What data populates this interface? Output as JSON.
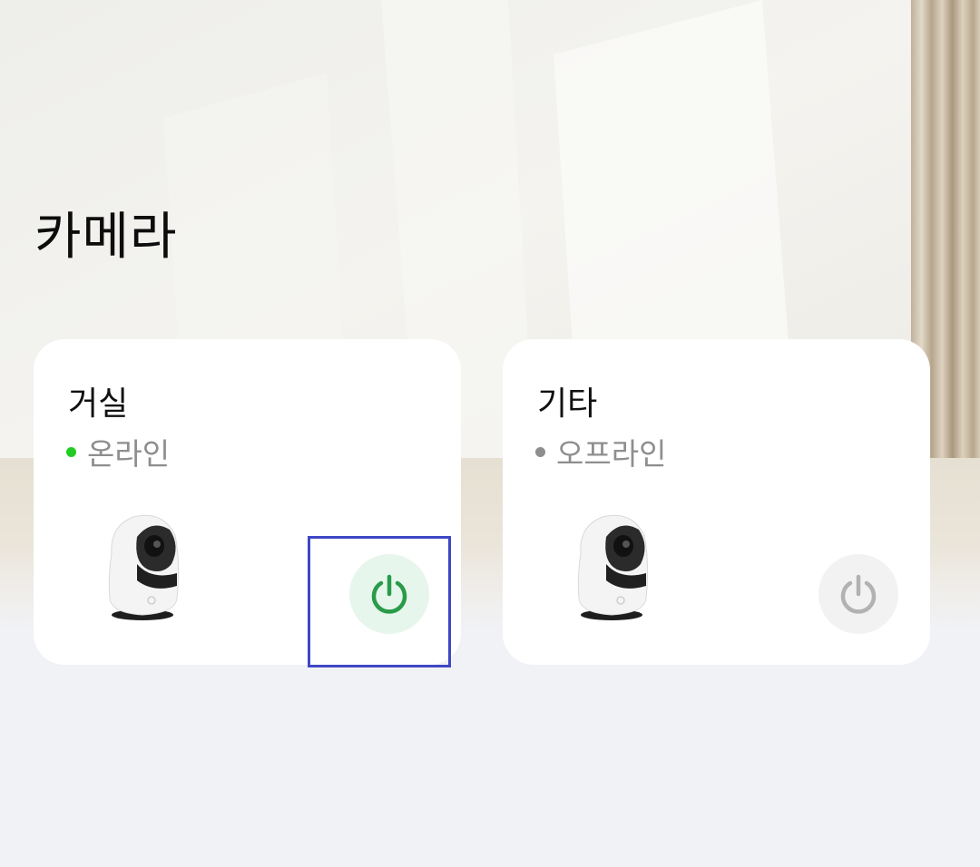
{
  "page": {
    "title": "카메라"
  },
  "cards": [
    {
      "name": "거실",
      "status_text": "온라인",
      "status_color": "#22cc22",
      "power_bg": "#e7f6ec",
      "power_color": "#2a9b4a",
      "power_state": "on"
    },
    {
      "name": "기타",
      "status_text": "오프라인",
      "status_color": "#8e8e8e",
      "power_bg": "#f2f2f2",
      "power_color": "#b2b2b2",
      "power_state": "off"
    }
  ],
  "icons": {
    "power": "power-icon",
    "camera": "camera-device-image"
  }
}
